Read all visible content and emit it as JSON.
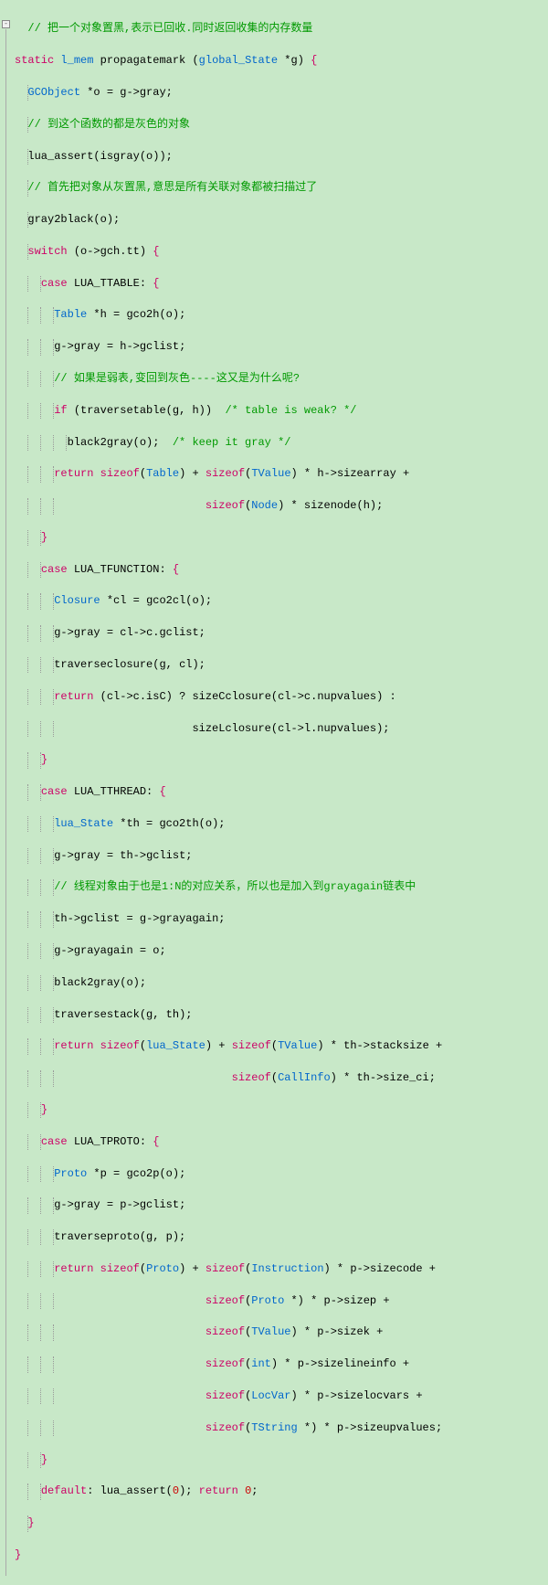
{
  "comments": {
    "c1": "// 把一个对象置黑,表示已回收.同时返回收集的内存数量",
    "c2": "// 到这个函数的都是灰色的对象",
    "c3": "// 首先把对象从灰置黑,意思是所有关联对象都被扫描过了",
    "c4": "// 如果是弱表,变回到灰色----这又是为什么呢?",
    "c5": "/* table is weak? */",
    "c6": "/* keep it gray */",
    "c7": "// 线程对象由于也是1:N的对应关系，所以也是加入到grayagain链表中"
  },
  "kw": {
    "static": "static",
    "switch": "switch",
    "case": "case",
    "if": "if",
    "return": "return",
    "default": "default",
    "sizeof": "sizeof"
  },
  "ty": {
    "l_mem": "l_mem",
    "global_State": "global_State",
    "GCObject": "GCObject",
    "Table": "Table",
    "TValue": "TValue",
    "Node": "Node",
    "Closure": "Closure",
    "lua_State": "lua_State",
    "CallInfo": "CallInfo",
    "Proto": "Proto",
    "Instruction": "Instruction",
    "int": "int",
    "LocVar": "LocVar",
    "TString": "TString"
  },
  "id": {
    "propagatemark": "propagatemark",
    "g": "g",
    "o": "o",
    "gray": "gray",
    "lua_assert": "lua_assert",
    "isgray": "isgray",
    "gray2black": "gray2black",
    "gch_tt": "gch.tt",
    "LUA_TTABLE": "LUA_TTABLE",
    "h": "h",
    "gco2h": "gco2h",
    "gclist": "gclist",
    "traversetable": "traversetable",
    "black2gray": "black2gray",
    "sizearray": "sizearray",
    "sizenode": "sizenode",
    "LUA_TFUNCTION": "LUA_TFUNCTION",
    "cl": "cl",
    "gco2cl": "gco2cl",
    "c_gclist": "c.gclist",
    "traverseclosure": "traverseclosure",
    "c_isC": "c.isC",
    "sizeCclosure": "sizeCclosure",
    "c_nupvalues": "c.nupvalues",
    "sizeLclosure": "sizeLclosure",
    "l_nupvalues": "l.nupvalues",
    "LUA_TTHREAD": "LUA_TTHREAD",
    "th": "th",
    "gco2th": "gco2th",
    "grayagain": "grayagain",
    "traversestack": "traversestack",
    "stacksize": "stacksize",
    "size_ci": "size_ci",
    "LUA_TPROTO": "LUA_TPROTO",
    "p": "p",
    "gco2p": "gco2p",
    "traverseproto": "traverseproto",
    "sizecode": "sizecode",
    "sizep": "sizep",
    "sizek": "sizek",
    "sizelineinfo": "sizelineinfo",
    "sizelocvars": "sizelocvars",
    "sizeupvalues": "sizeupvalues"
  },
  "num": {
    "zero": "0"
  },
  "fold": "-"
}
